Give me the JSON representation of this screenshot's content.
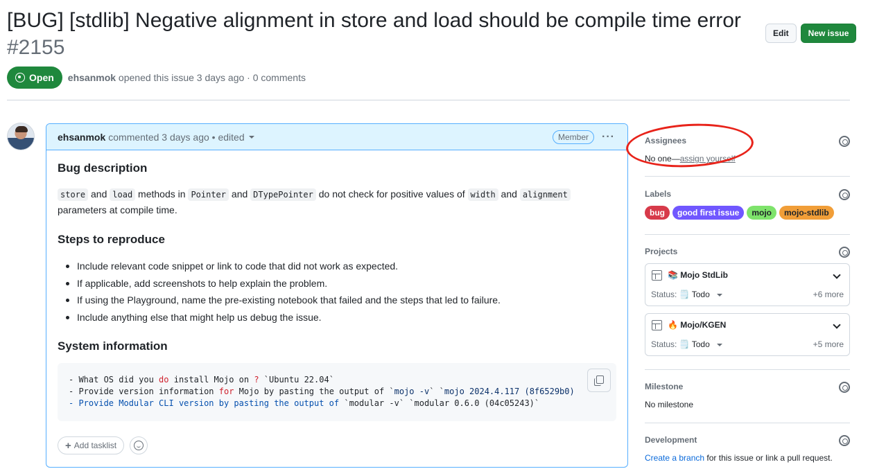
{
  "issue": {
    "title": "[BUG] [stdlib] Negative alignment in store and load should be compile time error",
    "number": "#2155",
    "edit_label": "Edit",
    "new_issue_label": "New issue",
    "state": "Open",
    "author": "ehsanmok",
    "opened_text": "opened this issue 3 days ago · 0 comments"
  },
  "comment": {
    "author": "ehsanmok",
    "meta": "commented 3 days ago • edited",
    "role_badge": "Member",
    "menu_glyph": "···",
    "h_bug": "Bug description",
    "bug_text": {
      "c1": "store",
      "t1": " and ",
      "c2": "load",
      "t2": " methods in ",
      "c3": "Pointer",
      "t3": " and ",
      "c4": "DTypePointer",
      "t4": " do not check for positive values of ",
      "c5": "width",
      "t5": " and ",
      "c6": "alignment",
      "t6": " parameters at compile time."
    },
    "h_steps": "Steps to reproduce",
    "steps": [
      "Include relevant code snippet or link to code that did not work as expected.",
      "If applicable, add screenshots to help explain the problem.",
      "If using the Playground, name the pre-existing notebook that failed and the steps that led to failure.",
      "Include anything else that might help us debug the issue."
    ],
    "h_sys": "System information",
    "code": {
      "l1a": "- What OS did you ",
      "l1kw": "do",
      "l1b": " install Mojo on ",
      "l1q": "?",
      "l1c": " `Ubuntu 22.04`",
      "l2a": "- Provide version information ",
      "l2kw": "for",
      "l2b": " Mojo by pasting the output of `",
      "l2s1": "mojo -v",
      "l2c": "` `",
      "l2s2": "mojo 2024.4.117 (8f6529b0)",
      "l3a": "- Provide Modular CLI version by pasting the output of ",
      "l3b": "`modular -v` `modular 0.6.0 (04c05243)`"
    },
    "add_tasklist": "Add tasklist"
  },
  "sidebar": {
    "assignees": {
      "title": "Assignees",
      "text": "No one—",
      "link": "assign yourself"
    },
    "labels": {
      "title": "Labels",
      "items": [
        {
          "name": "bug",
          "bg": "#d73a4a",
          "fg": "#ffffff"
        },
        {
          "name": "good first issue",
          "bg": "#7057ff",
          "fg": "#ffffff"
        },
        {
          "name": "mojo",
          "bg": "#a2eeef",
          "fg": "#1f2328"
        },
        {
          "name": "mojo-stdlib",
          "bg": "#f19e38",
          "fg": "#1f2328"
        }
      ]
    },
    "projects": {
      "title": "Projects",
      "items": [
        {
          "name": "📚 Mojo StdLib",
          "status_label": "Status:",
          "status": "🗒️ Todo",
          "more": "+6 more"
        },
        {
          "name": "🔥 Mojo/KGEN",
          "status_label": "Status:",
          "status": "🗒️ Todo",
          "more": "+5 more"
        }
      ]
    },
    "milestone": {
      "title": "Milestone",
      "text": "No milestone"
    },
    "development": {
      "title": "Development",
      "link": "Create a branch",
      "text": " for this issue or link a pull request."
    }
  },
  "colors": {
    "accent_green": "#1f883d",
    "link_blue": "#0969da",
    "annotation_red": "#e8231a"
  }
}
